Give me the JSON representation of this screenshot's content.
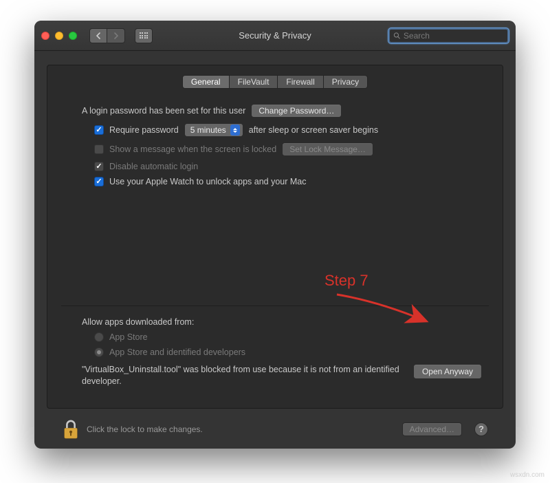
{
  "window": {
    "title": "Security & Privacy"
  },
  "search": {
    "placeholder": "Search"
  },
  "tabs": {
    "general": "General",
    "filevault": "FileVault",
    "firewall": "Firewall",
    "privacy": "Privacy"
  },
  "login": {
    "password_set_label": "A login password has been set for this user",
    "change_password_btn": "Change Password…",
    "require_password_label": "Require password",
    "require_delay_value": "5 minutes",
    "after_sleep_label": "after sleep or screen saver begins",
    "show_message_label": "Show a message when the screen is locked",
    "set_lock_message_btn": "Set Lock Message…",
    "disable_auto_login_label": "Disable automatic login",
    "apple_watch_label": "Use your Apple Watch to unlock apps and your Mac"
  },
  "downloads": {
    "heading": "Allow apps downloaded from:",
    "app_store": "App Store",
    "app_store_dev": "App Store and identified developers",
    "blocked_message": "\"VirtualBox_Uninstall.tool\" was blocked from use because it is not from an identified developer.",
    "open_anyway_btn": "Open Anyway"
  },
  "footer": {
    "lock_text": "Click the lock to make changes.",
    "advanced_btn": "Advanced…"
  },
  "annotation": {
    "step_label": "Step 7"
  },
  "watermark": "wsxdn.com"
}
